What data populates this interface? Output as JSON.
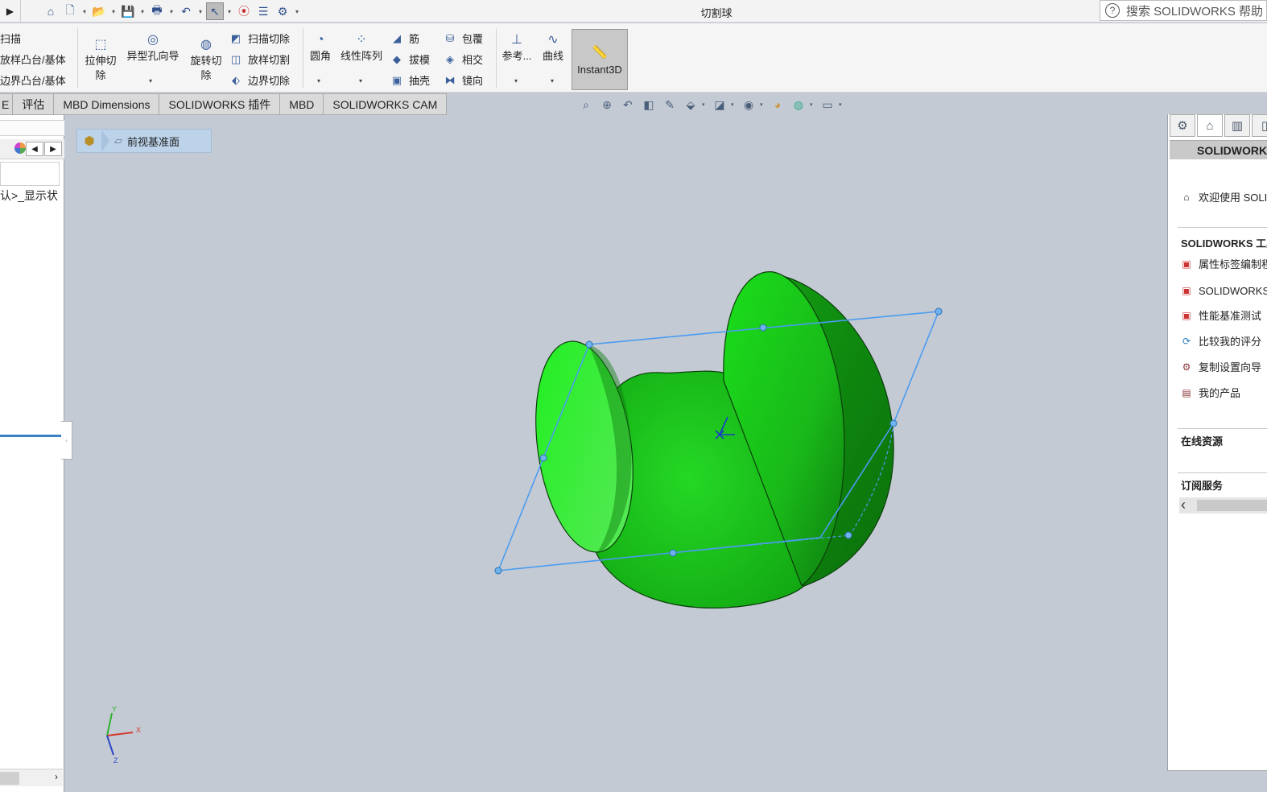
{
  "app": {
    "document_title": "切割球",
    "help_search_placeholder": "搜索 SOLIDWORKS 帮助"
  },
  "ribbon": {
    "sweep_label": "扫描",
    "loft_boss_label": "放样凸台/基体",
    "boundary_boss_label": "边界凸台/基体",
    "extruded_cut_label": "拉伸切\n除",
    "hole_wizard_label": "异型孔向导",
    "revolved_cut_label": "旋转切\n除",
    "swept_cut_label": "扫描切除",
    "lofted_cut_label": "放样切割",
    "boundary_cut_label": "边界切除",
    "fillet_label": "圆角",
    "linear_pattern_label": "线性阵列",
    "rib_label": "筋",
    "draft_label": "拔模",
    "shell_label": "抽壳",
    "wrap_label": "包覆",
    "intersect_label": "相交",
    "mirror_label": "镜向",
    "reference_label": "参考...",
    "curves_label": "曲线",
    "instant3d_label": "Instant3D"
  },
  "tabs": [
    {
      "label": "E"
    },
    {
      "label": "评估"
    },
    {
      "label": "MBD Dimensions"
    },
    {
      "label": "SOLIDWORKS 插件"
    },
    {
      "label": "MBD"
    },
    {
      "label": "SOLIDWORKS CAM"
    }
  ],
  "left_panel": {
    "configuration_text": "认>_显示状"
  },
  "breadcrumb": {
    "item_label": "前视基准面"
  },
  "triad": {
    "x_label": "X",
    "y_label": "Y",
    "z_label": "Z"
  },
  "task_pane": {
    "header": "SOLIDWORKS",
    "welcome": "欢迎使用 SOLIDWORKS",
    "tools_section": "SOLIDWORKS 工具",
    "tools": [
      {
        "label": "属性标签编制程序",
        "icon": "property-tab-icon"
      },
      {
        "label": "SOLIDWORKS Rx",
        "icon": "rx-icon"
      },
      {
        "label": "性能基准测试",
        "icon": "benchmark-icon"
      },
      {
        "label": "比较我的评分",
        "icon": "compare-score-icon"
      },
      {
        "label": "复制设置向导",
        "icon": "copy-settings-icon"
      },
      {
        "label": "我的产品",
        "icon": "my-products-icon"
      }
    ],
    "online_resources": "在线资源",
    "subscription_services": "订阅服务"
  },
  "colors": {
    "viewport_bg": "#c4cad4",
    "model_green": "#1ec21e",
    "plane_blue": "#4a9cf0"
  }
}
